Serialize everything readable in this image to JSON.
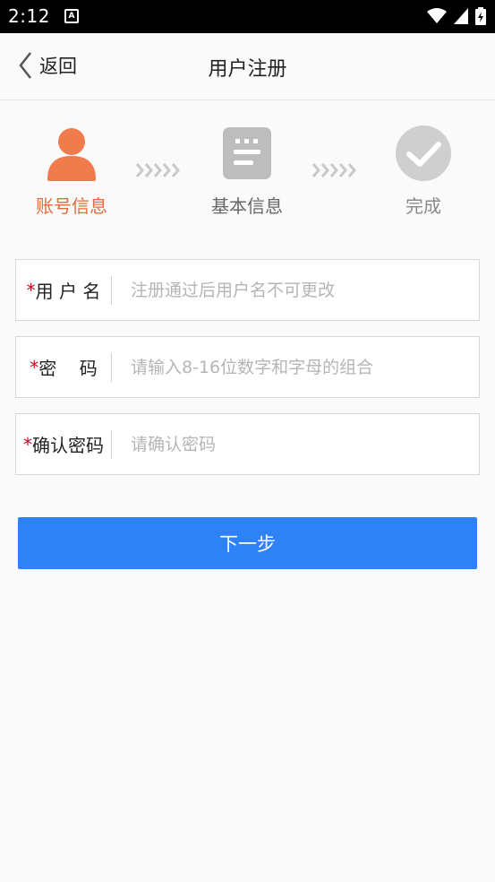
{
  "status_bar": {
    "time": "2:12",
    "notification_glyph": "A",
    "icons": [
      "wifi-icon",
      "signal-icon",
      "battery-icon"
    ]
  },
  "header": {
    "back_label": "返回",
    "title": "用户注册",
    "back_icon": "chevron-left-icon"
  },
  "steps": [
    {
      "label": "账号信息",
      "icon": "user-icon",
      "active": true,
      "color": "#f07b4c"
    },
    {
      "label": "基本信息",
      "icon": "document-icon",
      "active": false,
      "color": "#bdbdbd"
    },
    {
      "label": "完成",
      "icon": "check-circle-icon",
      "active": false,
      "color": "#cfcfcf"
    }
  ],
  "form": {
    "username": {
      "star": "*",
      "label": "用 户 名",
      "placeholder": "注册通过后用户名不可更改",
      "value": ""
    },
    "password": {
      "star": "*",
      "label": "密    码",
      "placeholder": "请输入8-16位数字和字母的组合",
      "value": ""
    },
    "confirm": {
      "star": "*",
      "label": "确认密码",
      "placeholder": "请确认密码",
      "value": ""
    }
  },
  "next_button": {
    "label": "下一步",
    "color": "#2f82f5"
  }
}
